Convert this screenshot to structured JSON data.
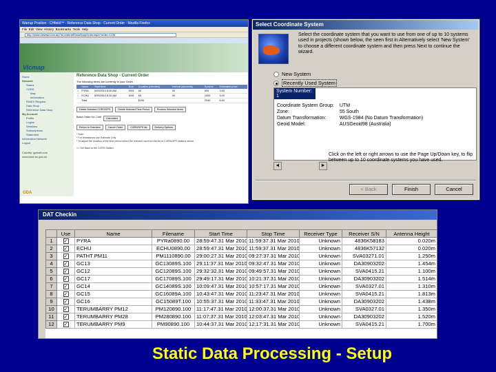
{
  "browser": {
    "window_title": "Warrup Position - CHfield™ - Reference Data Shop - Current Order - Mozilla Firefox",
    "address": "http://www.viewsw.com.au/?a=orderrefDataShopOrder.aspx?order=1234",
    "banner_logo": "Vicmap",
    "nav": [
      {
        "label": "Home",
        "level": 0
      },
      {
        "label": "Network",
        "level": 0,
        "bold": true
      },
      {
        "label": "Status",
        "level": 1
      },
      {
        "label": "CORS",
        "level": 1
      },
      {
        "label": "Map",
        "level": 2
      },
      {
        "label": "Information",
        "level": 2
      },
      {
        "label": "RINEX Request",
        "level": 1
      },
      {
        "label": "Data Shop",
        "level": 1
      },
      {
        "label": "Reference Data Shop",
        "level": 1
      },
      {
        "label": "My Account",
        "level": 0,
        "bold": true
      },
      {
        "label": "Profile",
        "level": 1
      },
      {
        "label": "Logins",
        "level": 1
      },
      {
        "label": "Sessions",
        "level": 1
      },
      {
        "label": "Subscriptions",
        "level": 1
      },
      {
        "label": "Statement",
        "level": 1
      },
      {
        "label": "Information Network",
        "level": 0
      },
      {
        "label": "Logout",
        "level": 0
      }
    ],
    "nav_footer": "Country: gpsnet.com\nwww.land.vic.gov.au",
    "page_title": "Reference Data Shop - Current Order",
    "intro": "The following items are currently in your Order",
    "order_headers": [
      "",
      "Name",
      "Start time",
      "End",
      "Duration (minutes)",
      "Interval (seconds)",
      "Epochs",
      "Estimated price"
    ],
    "order_rows": [
      [
        "○",
        "PYRA",
        "5/09/2010 8:00 AM",
        "5/09",
        "50",
        "30",
        "500",
        "3.00"
      ],
      [
        "○",
        "ECHU",
        "5/09/2010 8:30 AM",
        "5/09",
        "60",
        "30",
        "1000",
        "3.00"
      ],
      [
        "",
        "Total",
        "",
        "",
        "$190",
        "",
        "2040",
        "6.00"
      ]
    ],
    "buttons_row1": [
      "Delete Selected CORS/GPS",
      "Delete Selected Time Period",
      "Process Selected Items"
    ],
    "batch_label": "Batch Order for: Cost",
    "batch_select": "Calculated",
    "buttons_row2": [
      "Return to Overview",
      "Cancel Order",
      "CORS/GPS list",
      "Delivery Options"
    ],
    "notes": "* Note:\n* For timestamps use Estimate Only\n* To adjust the duration of the time period select the relevant row from the list of CORS/GPS stations above.\n\n<<  Get Back to the CORS Station",
    "footer_logo": "GDA"
  },
  "dialog": {
    "title": "Select Coordinate System",
    "intro": "Select the coordinate system that you want to use from one of up to 10 systems used in projects (shown below, the seen first in Alternatively select 'New System' to choose a different coordinate system and then press Next to continue the wizard.",
    "radio_new": "New System",
    "radio_recent": "Recently Used System",
    "list_selected": "System Number: 1",
    "fields": [
      {
        "label": "Coordinate System Group:",
        "value": "UTM"
      },
      {
        "label": "Zone:",
        "value": "55 South"
      },
      {
        "label": "Datum Transformation:",
        "value": "WGS-1984 (No Datum Transformation)"
      },
      {
        "label": "Geoid Model:",
        "value": "AUSGeoid98 (Australia)"
      }
    ],
    "help_text": "Click on the left or right arrows to use the Page Up/Down key, to flip between up to 10 coordinate systems you have used.",
    "btn_back": "< Back",
    "btn_finish": "Finish",
    "btn_cancel": "Cancel"
  },
  "dat": {
    "title": "DAT Checkin",
    "headers": [
      "",
      "Use",
      "Name",
      "Filename",
      "Start Time",
      "Stop Time",
      "Receiver Type",
      "Receiver S/N",
      "Antenna Height"
    ],
    "rows": [
      [
        "1",
        "✓",
        "PYRA",
        "PYRa0890.00",
        "28:59:47.31 Mar 2010",
        "11:59:37.31 Mar 2010",
        "Unknown",
        "4836K58183",
        "0.020m"
      ],
      [
        "2",
        "✓",
        "ECHU",
        "ECHU0890.00",
        "28:59:47.31 Mar 2010",
        "11:59:37.31 Mar 2010",
        "Unknown",
        "4836K57132",
        "0.020m"
      ],
      [
        "3",
        "✓",
        "PATHT PM11",
        "PM1110890.00",
        "29:00:27.31 Mar 2010",
        "09:27:37.31 Mar 2010",
        "Unknown",
        "SVA03271.01",
        "1.250m"
      ],
      [
        "4",
        "✓",
        "GC13",
        "GC13089S.100",
        "29:11:37.31 Mar 2010",
        "09:32:47.31 Mar 2010",
        "Unknown",
        "DA30903202",
        "1.454m"
      ],
      [
        "5",
        "✓",
        "GC12",
        "GC12089S.100",
        "29:32:32.31 Mar 2010",
        "09:49:57.31 Mar 2010",
        "Unknown",
        "SVA0415.21",
        "1.100m"
      ],
      [
        "6",
        "✓",
        "GC17",
        "GC17089S.100",
        "29:49:17.31 Mar 2010",
        "10:21:37.31 Mar 2010",
        "Unknown",
        "DA30903202",
        "1.514m"
      ],
      [
        "7",
        "✓",
        "GC14",
        "GC14089S.100",
        "10:09:47.31 Mar 2010",
        "10:57:17.31 Mar 2010",
        "Unknown",
        "SVA0327.01",
        "1.310m"
      ],
      [
        "8",
        "✓",
        "GC15",
        "GC16089A.100",
        "10:43:47.31 Mar 2010",
        "11:23:47.31 Mar 2010",
        "Unknown",
        "SVA0415.21",
        "1.813m"
      ],
      [
        "9",
        "✓",
        "GC16",
        "GC15089T.100",
        "10:55:37.31 Mar 2010",
        "11:33:47.31 Mar 2010",
        "Unknown",
        "DA30903202",
        "1.438m"
      ],
      [
        "10",
        "✓",
        "TERUMBARRY PM12",
        "PM120890.100",
        "11:17:47.31 Mar 2010",
        "12:00:37.31 Mar 2010",
        "Unknown",
        "SVA0327.01",
        "1.350m"
      ],
      [
        "11",
        "✓",
        "TERUMBARRY PM28",
        "PM280890.100",
        "11:07:37.31 Mar 2010",
        "12:03:47.31 Mar 2010",
        "Unknown",
        "DA30903202",
        "1.520m"
      ],
      [
        "12",
        "✓",
        "TERUMBARRY PM9",
        "PM90890.100",
        "10:44:37.31 Mar 2010",
        "12:17:31.31 Mar 2010",
        "Unknown",
        "SVA0415.21",
        "1.700m"
      ]
    ]
  },
  "caption": "Static Data Processing - Setup"
}
